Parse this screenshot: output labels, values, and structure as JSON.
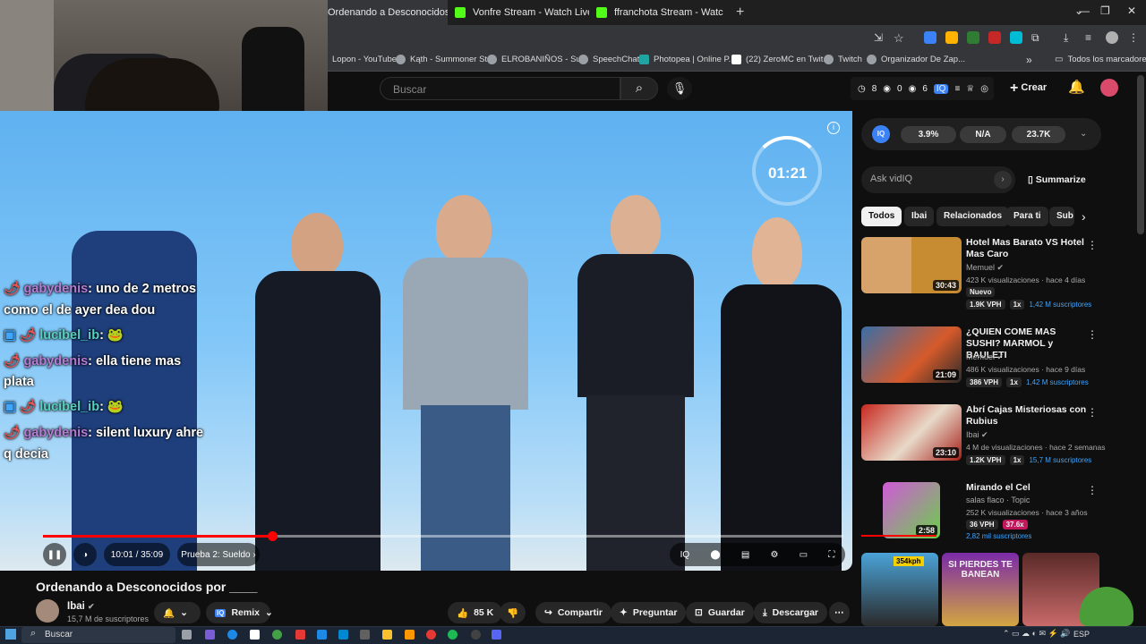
{
  "browser": {
    "tabs": [
      {
        "label": "Ordenando a Desconocidos",
        "active": true
      },
      {
        "label": "Vonfre Stream - Watch Live",
        "active": false
      },
      {
        "label": "ffranchota Stream - Watch",
        "active": false
      }
    ],
    "new_tab": "+",
    "bookmarks": [
      "Lopon - YouTube",
      "Kąth - Summoner St...",
      "ELROBANIÑOS - Su...",
      "SpeechChat",
      "Photopea | Online P...",
      "(22) ZeroMC en Twit...",
      "Twitch",
      "Organizador De Zap..."
    ],
    "bookmarks_more": "»",
    "all_bookmarks": "Todos los marcadores"
  },
  "header": {
    "search_placeholder": "Buscar",
    "stats": [
      "8",
      "0",
      "6"
    ],
    "create_label": "Crear"
  },
  "video": {
    "timer": "01:21",
    "time": "10:01 / 35:09",
    "chapter": "Prueba 2: Sueldo",
    "progress_fraction": 0.286,
    "title": "Ordenando a Desconocidos por ____"
  },
  "channel": {
    "name": "Ibai",
    "subs": "15,7 M de suscriptores",
    "remix": "Remix",
    "likes": "85 K",
    "share": "Compartir",
    "ask": "Preguntar",
    "save": "Guardar",
    "download": "Descargar"
  },
  "chat": [
    {
      "user": "gabydenis",
      "msg": ": uno de 2 metros"
    },
    {
      "cont": "como el de ayer dea dou"
    },
    {
      "user": "lucibel_ib",
      "msg": ": 🐸"
    },
    {
      "user": "gabydenis",
      "msg": ": ella tiene mas"
    },
    {
      "cont": "plata"
    },
    {
      "user": "lucibel_ib",
      "msg": ": 🐸"
    },
    {
      "user": "gabydenis",
      "msg": ": silent luxury ahre"
    },
    {
      "cont": "q decia"
    }
  ],
  "vidiq": {
    "logo": "IQ",
    "values": [
      "3.9%",
      "N/A",
      "23.7K"
    ],
    "ask_placeholder": "Ask vidIQ",
    "summarize": "Summarize"
  },
  "chips": [
    "Todos",
    "Ibai",
    "Relacionados",
    "Para ti",
    "Sub"
  ],
  "recommendations": [
    {
      "title": "Hotel Mas Barato VS Hotel Mas Caro",
      "channel": "Memuel",
      "views": "423 K visualizaciones · hace 4 días",
      "badge": "Nuevo",
      "vph": "1.9K VPH",
      "mult": "1x",
      "subs": "1,42 M suscriptores",
      "duration": "30:43"
    },
    {
      "title": "¿QUIEN COME MAS SUSHI? MARMOL y BAULETI",
      "channel": "Memuel",
      "views": "486 K visualizaciones · hace 9 días",
      "vph": "386 VPH",
      "mult": "1x",
      "subs": "1,42 M suscriptores",
      "duration": "21:09"
    },
    {
      "title": "Abrí Cajas Misteriosas con Rubius",
      "channel": "Ibai",
      "views": "4 M de visualizaciones · hace 2 semanas",
      "vph": "1.2K VPH",
      "mult": "1x",
      "subs": "15,7 M suscriptores",
      "duration": "23:10"
    },
    {
      "title": "Mirando el Cel",
      "channel": "salas flaco · Topic",
      "views": "252 K visualizaciones · hace 3 años",
      "vph": "36 VPH",
      "mult": "37.6x",
      "subs": "2,82 mil suscriptores",
      "duration": "2:58"
    }
  ],
  "shorts": [
    "354kph",
    "SI PIERDES TE BANEAN",
    ""
  ],
  "taskbar": {
    "search": "Buscar",
    "lang": "ESP"
  }
}
